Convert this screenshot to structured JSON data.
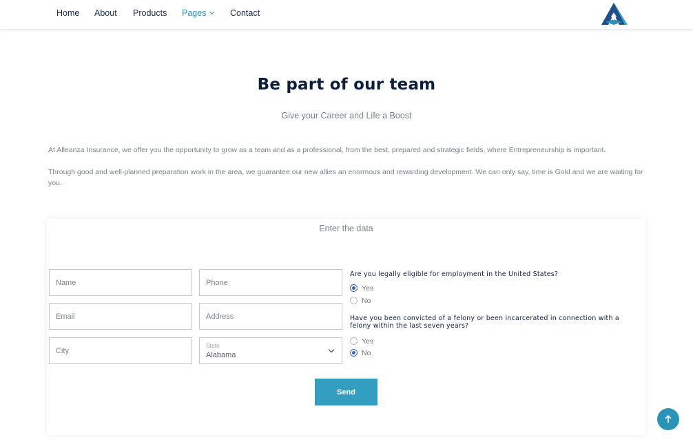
{
  "nav": {
    "items": [
      {
        "label": "Home"
      },
      {
        "label": "About"
      },
      {
        "label": "Products"
      },
      {
        "label": "Pages"
      },
      {
        "label": "Contact"
      }
    ],
    "active": "Pages"
  },
  "hero": {
    "title": "Be part of our team",
    "subtitle": "Give your Career and Life a Boost",
    "paragraphs": [
      "At Alleanza Insurance, we offer you the opportunity to grow as a team and as a professional, from the best, prepared and strategic fields, where Entrepreneurship is important.",
      "Through good and well-planned preparation work in the area, we guarantee our new allies an enormous and rewarding development. We can only say, time is Gold and we are waiting for you."
    ]
  },
  "form": {
    "title": "Enter the data",
    "fields": {
      "name": {
        "placeholder": "Name",
        "value": ""
      },
      "phone": {
        "placeholder": "Phone",
        "value": ""
      },
      "email": {
        "placeholder": "Email",
        "value": ""
      },
      "address": {
        "placeholder": "Address",
        "value": ""
      },
      "city": {
        "placeholder": "City",
        "value": ""
      },
      "state": {
        "label": "State",
        "value": "Alabama"
      }
    },
    "questions": [
      {
        "text": "Are you legally eligible for employment in the United States?",
        "options": [
          "Yes",
          "No"
        ],
        "selected": "Yes"
      },
      {
        "text": "Have you been convicted of a felony or been incarcerated in connection with a felony within the last seven years?",
        "options": [
          "Yes",
          "No"
        ],
        "selected": "No"
      }
    ],
    "submit_label": "Send"
  },
  "colors": {
    "accent": "#339ec0",
    "nav_active": "#2f8fb3",
    "heading": "#0d1e3d",
    "radio_checked": "#3767b0"
  },
  "icons": {
    "logo": "alleanza-logo-icon",
    "scroll_top": "arrow-up-icon",
    "select_chevron": "chevron-down-icon"
  }
}
